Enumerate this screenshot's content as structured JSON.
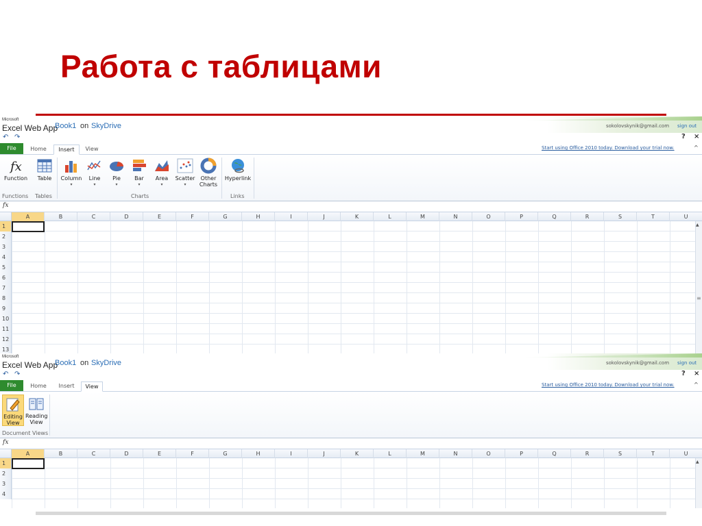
{
  "slide": {
    "title": "Работа с таблицами"
  },
  "app": {
    "brand_small": "Microsoft",
    "brand_name": "Excel Web App",
    "book_name": "Book1",
    "on_word": "on",
    "location": "SkyDrive",
    "user_email": "sokolovskynik@gmail.com",
    "sign_out": "sign out",
    "help": "?",
    "close": "×",
    "promo": "Start using Office 2010 today. Download your trial now.",
    "collapse": "^",
    "fx_label": "fx"
  },
  "window1": {
    "tabs": [
      "File",
      "Home",
      "Insert",
      "View"
    ],
    "active_tab": "Insert",
    "ribbon": {
      "function": "Function",
      "table": "Table",
      "column": "Column",
      "line": "Line",
      "pie": "Pie",
      "bar": "Bar",
      "area": "Area",
      "scatter": "Scatter",
      "other1": "Other",
      "other2": "Charts",
      "hyperlink": "Hyperlink",
      "groups": {
        "functions": "Functions",
        "tables": "Tables",
        "charts": "Charts",
        "links": "Links"
      }
    },
    "columns": [
      "A",
      "B",
      "C",
      "D",
      "E",
      "F",
      "G",
      "H",
      "I",
      "J",
      "K",
      "L",
      "M",
      "N",
      "O",
      "P",
      "Q",
      "R",
      "S",
      "T",
      "U"
    ],
    "rows": [
      "1",
      "2",
      "3",
      "4",
      "5",
      "6",
      "7",
      "8",
      "9",
      "10",
      "11",
      "12",
      "13"
    ],
    "selected_cell": "A1"
  },
  "window2": {
    "tabs": [
      "File",
      "Home",
      "Insert",
      "View"
    ],
    "active_tab": "View",
    "ribbon": {
      "editing1": "Editing",
      "editing2": "View",
      "reading1": "Reading",
      "reading2": "View",
      "groups": {
        "document_views": "Document Views"
      }
    },
    "columns": [
      "A",
      "B",
      "C",
      "D",
      "E",
      "F",
      "G",
      "H",
      "I",
      "J",
      "K",
      "L",
      "M",
      "N",
      "O",
      "P",
      "Q",
      "R",
      "S",
      "T",
      "U"
    ],
    "rows": [
      "1",
      "2",
      "3",
      "4"
    ],
    "selected_cell": "A1"
  },
  "colors": {
    "title_red": "#c00000",
    "file_tab_green": "#2e8b2e",
    "link_blue": "#2a6db5",
    "selection_gold": "#f8d788"
  }
}
